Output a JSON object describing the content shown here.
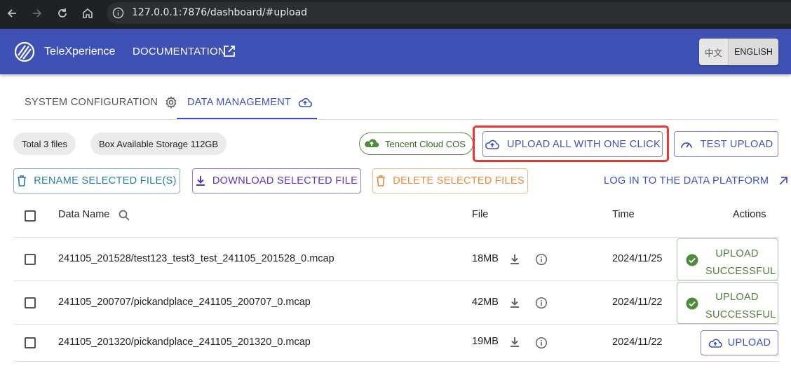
{
  "browser": {
    "url": "127.0.0.1:7876/dashboard/#upload",
    "icons": [
      "back-icon",
      "forward-icon",
      "reload-icon",
      "home-icon",
      "info-icon"
    ]
  },
  "header": {
    "app_name": "TeleXperience",
    "doc_link": "DOCUMENTATION",
    "lang_zh": "中文",
    "lang_en": "ENGLISH",
    "brand_color": "#3f51b5"
  },
  "tabs": [
    {
      "label": "SYSTEM CONFIGURATION",
      "icon": "gear-icon",
      "active": false
    },
    {
      "label": "DATA MANAGEMENT",
      "icon": "cloud-upload-icon",
      "active": true
    }
  ],
  "summary": {
    "total_files": "Total 3 files",
    "storage": "Box Available Storage 112GB",
    "cloud_target": "Tencent Cloud COS"
  },
  "actions": {
    "upload_all": "UPLOAD ALL WITH ONE CLICK",
    "test_upload": "TEST UPLOAD",
    "rename": "RENAME SELECTED FILE(S)",
    "download": "DOWNLOAD SELECTED FILE",
    "delete": "DELETE SELECTED FILES",
    "platform_link": "LOG IN TO THE DATA PLATFORM"
  },
  "table": {
    "columns": {
      "name": "Data Name",
      "file": "File",
      "time": "Time",
      "actions": "Actions"
    },
    "rows": [
      {
        "name": "241105_201528/test123_test3_test_241105_201528_0.mcap",
        "size": "18MB",
        "time": "2024/11/25",
        "status_line1": "UPLOAD",
        "status_line2": "SUCCESSFUL"
      },
      {
        "name": "241105_200707/pickandplace_241105_200707_0.mcap",
        "size": "42MB",
        "time": "2024/11/22",
        "status_line1": "UPLOAD",
        "status_line2": "SUCCESSFUL"
      },
      {
        "name": "241105_201320/pickandplace_241105_201320_0.mcap",
        "size": "19MB",
        "time": "2024/11/22",
        "action": "UPLOAD"
      }
    ]
  },
  "colors": {
    "highlight": "#e53935",
    "success": "#4f7c3d",
    "rename": "#2a7c9e",
    "download": "#5e35b1",
    "delete": "#e8893b"
  }
}
